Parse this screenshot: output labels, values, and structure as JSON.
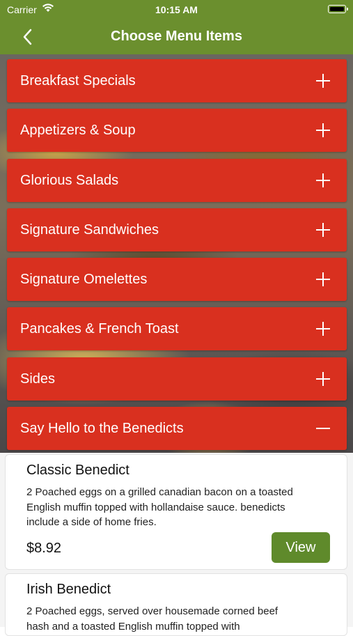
{
  "status_bar": {
    "carrier": "Carrier",
    "time": "10:15 AM"
  },
  "nav": {
    "title": "Choose Menu Items"
  },
  "categories": [
    {
      "label": "Breakfast Specials",
      "expanded": false
    },
    {
      "label": "Appetizers & Soup",
      "expanded": false
    },
    {
      "label": "Glorious Salads",
      "expanded": false
    },
    {
      "label": "Signature Sandwiches",
      "expanded": false
    },
    {
      "label": "Signature Omelettes",
      "expanded": false
    },
    {
      "label": "Pancakes & French Toast",
      "expanded": false
    },
    {
      "label": "Sides",
      "expanded": false
    },
    {
      "label": "Say Hello to the Benedicts",
      "expanded": true
    }
  ],
  "items": [
    {
      "name": "Classic Benedict",
      "description": "2 Poached eggs on a grilled canadian bacon on a toasted English muffin topped with hollandaise sauce. benedicts include a side of home fries.",
      "price": "$8.92",
      "button": "View"
    },
    {
      "name": "Irish Benedict",
      "description": "2 Poached eggs, served over housemade corned beef hash and a toasted English muffin topped with"
    }
  ],
  "colors": {
    "nav_green": "#6b8f2e",
    "category_red": "#d9301f",
    "view_button_green": "#5f8a2b"
  },
  "icons": {
    "back": "chevron-left-icon",
    "expand": "plus-icon",
    "collapse": "minus-icon"
  }
}
